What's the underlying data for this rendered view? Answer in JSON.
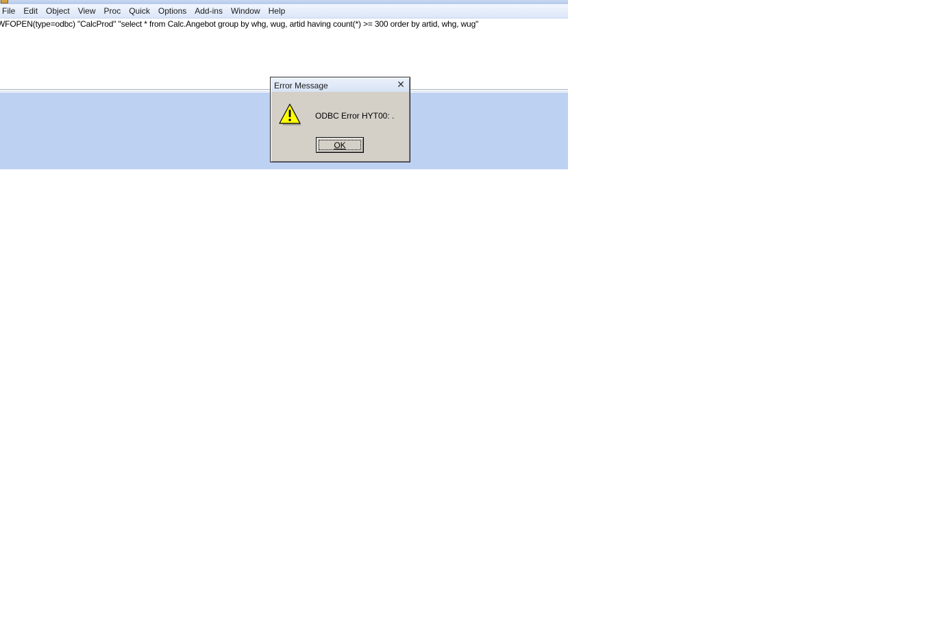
{
  "menubar": {
    "items": [
      "File",
      "Edit",
      "Object",
      "View",
      "Proc",
      "Quick",
      "Options",
      "Add-ins",
      "Window",
      "Help"
    ]
  },
  "command": {
    "text": "WFOPEN(type=odbc) \"CalcProd\" \"select * from Calc.Angebot group by whg, wug, artid having count(*) >= 300 order by artid, whg, wug\""
  },
  "dialog": {
    "title": "Error Message",
    "close_symbol": "✕",
    "message": "ODBC Error HYT00: .",
    "ok_label": "OK",
    "icon": "warning-icon"
  },
  "colors": {
    "workspace": "#bdd1f2",
    "dialog_face": "#d4d0c8",
    "warning_fill": "#ffff00"
  }
}
